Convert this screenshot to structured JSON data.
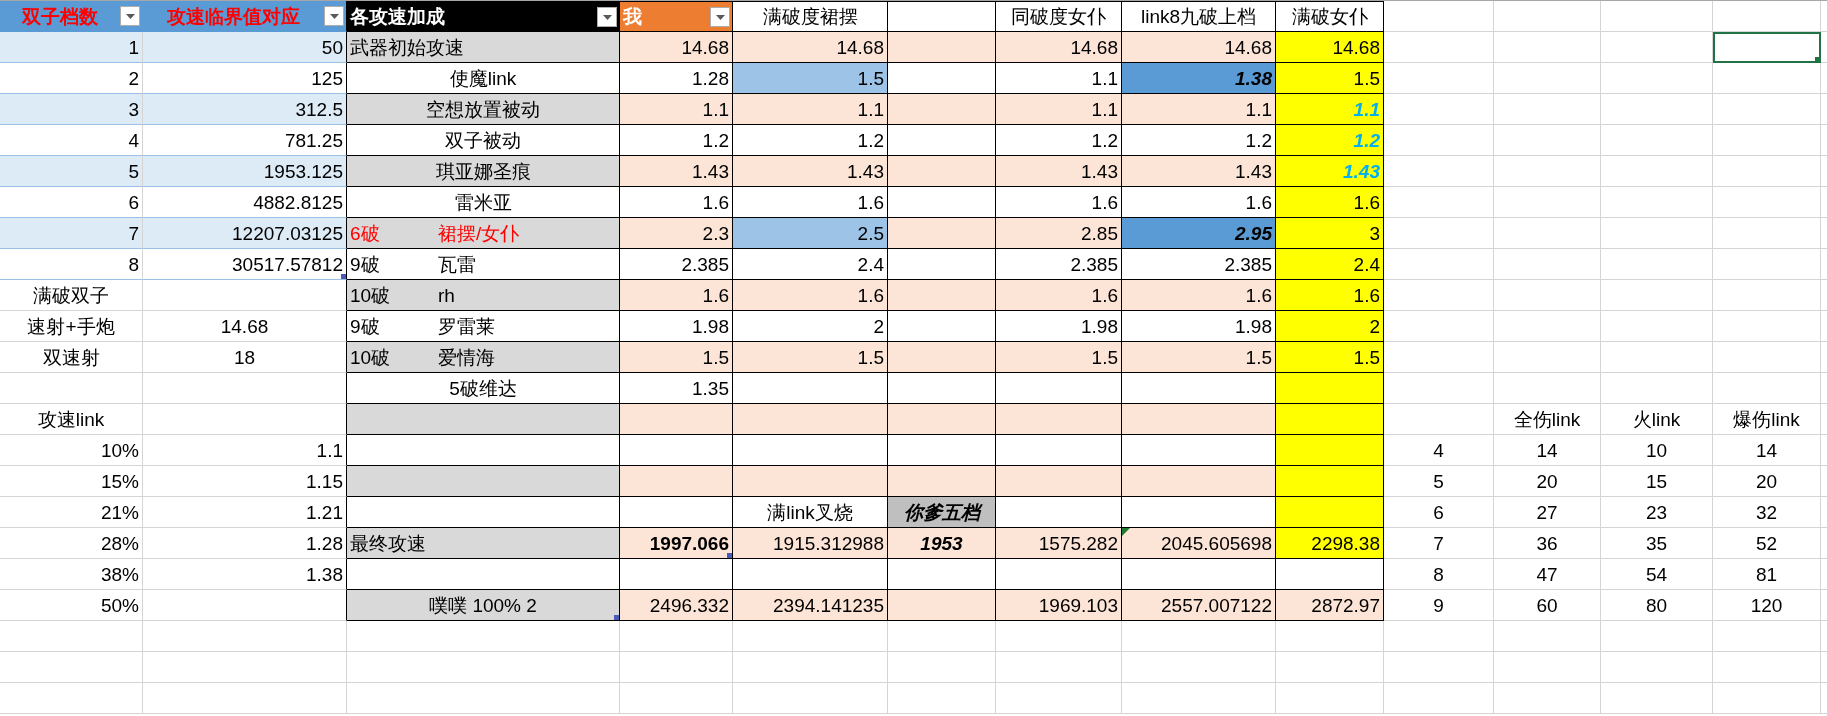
{
  "sheet": {
    "rows": [
      {
        "cells": [
          {
            "kind": "head-blue",
            "text": "双子档数",
            "centered": true,
            "bold": true,
            "color": "#ff0000",
            "filter": true
          },
          {
            "kind": "head-blue",
            "text": "攻速临界值对应",
            "centered": true,
            "bold": true,
            "color": "#ff0000",
            "filter": true
          },
          {
            "kind": "head-dark",
            "text": "各攻速加成",
            "left_aligned": true,
            "bold": true,
            "color": "#ffffff",
            "filter": true
          },
          {
            "kind": "head-orange",
            "text": "我",
            "left_aligned": true,
            "bold": true,
            "color": "#ffffff",
            "filter": true
          },
          {
            "kind": "cell",
            "text": "满破度裙摆",
            "centered": true
          },
          {
            "kind": "cell"
          },
          {
            "kind": "cell",
            "text": "同破度女仆",
            "centered": true
          },
          {
            "kind": "cell",
            "text": "link8九破上档",
            "centered": true
          },
          {
            "kind": "cell",
            "text": "满破女仆",
            "centered": true
          }
        ]
      },
      {
        "cells": [
          {
            "kind": "band",
            "text": "1"
          },
          {
            "kind": "band",
            "text": "50"
          },
          {
            "kind": "gray",
            "text": "武器初始攻速",
            "left_aligned": true
          },
          {
            "kind": "peach",
            "text": "14.68"
          },
          {
            "kind": "peach",
            "text": "14.68"
          },
          {
            "kind": "peach"
          },
          {
            "kind": "peach",
            "text": "14.68"
          },
          {
            "kind": "peach",
            "text": "14.68"
          },
          {
            "kind": "yellow",
            "text": "14.68"
          },
          {
            "kind": "plain"
          },
          {
            "kind": "plain"
          },
          {
            "kind": "plain"
          },
          {
            "kind": "plain",
            "selected": true
          }
        ]
      },
      {
        "cells": [
          {
            "kind": "band-white",
            "text": "2"
          },
          {
            "kind": "band-white",
            "text": "125"
          },
          {
            "kind": "cell",
            "text": "使魔link",
            "centered": true
          },
          {
            "kind": "cell",
            "text": "1.28"
          },
          {
            "kind": "light-blue",
            "text": "1.5"
          },
          {
            "kind": "cell"
          },
          {
            "kind": "cell",
            "text": "1.1"
          },
          {
            "kind": "blue",
            "text": "1.38",
            "bold": true,
            "italic": true
          },
          {
            "kind": "yellow",
            "text": "1.5"
          }
        ]
      },
      {
        "cells": [
          {
            "kind": "band",
            "text": "3"
          },
          {
            "kind": "band",
            "text": "312.5"
          },
          {
            "kind": "gray",
            "text": "空想放置被动",
            "centered": true
          },
          {
            "kind": "peach",
            "text": "1.1"
          },
          {
            "kind": "peach",
            "text": "1.1"
          },
          {
            "kind": "peach"
          },
          {
            "kind": "peach",
            "text": "1.1"
          },
          {
            "kind": "peach",
            "text": "1.1"
          },
          {
            "kind": "yellow",
            "text": "1.1",
            "bold": true,
            "italic": true,
            "color": "#00b0f0"
          }
        ]
      },
      {
        "cells": [
          {
            "kind": "band-white",
            "text": "4"
          },
          {
            "kind": "band-white",
            "text": "781.25"
          },
          {
            "kind": "cell",
            "text": "双子被动",
            "centered": true
          },
          {
            "kind": "cell",
            "text": "1.2"
          },
          {
            "kind": "cell",
            "text": "1.2"
          },
          {
            "kind": "cell"
          },
          {
            "kind": "cell",
            "text": "1.2"
          },
          {
            "kind": "cell",
            "text": "1.2"
          },
          {
            "kind": "yellow",
            "text": "1.2",
            "bold": true,
            "italic": true,
            "color": "#00b0f0"
          }
        ]
      },
      {
        "cells": [
          {
            "kind": "band",
            "text": "5"
          },
          {
            "kind": "band",
            "text": "1953.125"
          },
          {
            "kind": "gray",
            "text": "琪亚娜圣痕",
            "centered": true
          },
          {
            "kind": "peach",
            "text": "1.43"
          },
          {
            "kind": "peach",
            "text": "1.43"
          },
          {
            "kind": "peach"
          },
          {
            "kind": "peach",
            "text": "1.43"
          },
          {
            "kind": "peach",
            "text": "1.43"
          },
          {
            "kind": "yellow",
            "text": "1.43",
            "bold": true,
            "italic": true,
            "color": "#00b0f0"
          }
        ]
      },
      {
        "cells": [
          {
            "kind": "band-white",
            "text": "6"
          },
          {
            "kind": "band-white",
            "text": "4882.8125"
          },
          {
            "kind": "cell",
            "text": "雷米亚",
            "centered": true
          },
          {
            "kind": "cell",
            "text": "1.6"
          },
          {
            "kind": "cell",
            "text": "1.6"
          },
          {
            "kind": "cell"
          },
          {
            "kind": "cell",
            "text": "1.6"
          },
          {
            "kind": "cell",
            "text": "1.6"
          },
          {
            "kind": "yellow",
            "text": "1.6"
          }
        ]
      },
      {
        "cells": [
          {
            "kind": "band",
            "text": "7"
          },
          {
            "kind": "band",
            "text": "12207.03125"
          },
          {
            "kind": "gray",
            "prefix": "6破",
            "text": "裙摆/女仆",
            "left_aligned": true,
            "color": "#ff0000"
          },
          {
            "kind": "peach",
            "text": "2.3"
          },
          {
            "kind": "light-blue",
            "text": "2.5"
          },
          {
            "kind": "peach"
          },
          {
            "kind": "peach",
            "text": "2.85"
          },
          {
            "kind": "blue",
            "text": "2.95",
            "bold": true,
            "italic": true
          },
          {
            "kind": "yellow",
            "text": "3"
          }
        ]
      },
      {
        "cells": [
          {
            "kind": "band-white",
            "text": "8"
          },
          {
            "kind": "band-white",
            "text": "30517.57812",
            "corner_mark": true
          },
          {
            "kind": "cell",
            "prefix": "9破",
            "text": "瓦雷",
            "left_aligned": true
          },
          {
            "kind": "cell",
            "text": "2.385"
          },
          {
            "kind": "cell",
            "text": "2.4"
          },
          {
            "kind": "cell"
          },
          {
            "kind": "cell",
            "text": "2.385"
          },
          {
            "kind": "cell",
            "text": "2.385"
          },
          {
            "kind": "yellow",
            "text": "2.4"
          }
        ]
      },
      {
        "cells": [
          {
            "kind": "plain",
            "text": "满破双子",
            "centered": true
          },
          {
            "kind": "plain"
          },
          {
            "kind": "gray",
            "prefix": "10破",
            "text": "rh",
            "left_aligned": true
          },
          {
            "kind": "peach",
            "text": "1.6"
          },
          {
            "kind": "peach",
            "text": "1.6"
          },
          {
            "kind": "peach"
          },
          {
            "kind": "peach",
            "text": "1.6"
          },
          {
            "kind": "peach",
            "text": "1.6"
          },
          {
            "kind": "yellow",
            "text": "1.6"
          }
        ]
      },
      {
        "cells": [
          {
            "kind": "plain",
            "text": "速射+手炮",
            "centered": true
          },
          {
            "kind": "plain",
            "text": "14.68",
            "centered": true
          },
          {
            "kind": "cell",
            "prefix": "9破",
            "text": "罗雷莱",
            "left_aligned": true
          },
          {
            "kind": "cell",
            "text": "1.98"
          },
          {
            "kind": "cell",
            "text": "2"
          },
          {
            "kind": "cell"
          },
          {
            "kind": "cell",
            "text": "1.98"
          },
          {
            "kind": "cell",
            "text": "1.98"
          },
          {
            "kind": "yellow",
            "text": "2"
          }
        ]
      },
      {
        "cells": [
          {
            "kind": "plain",
            "text": "双速射",
            "centered": true
          },
          {
            "kind": "plain",
            "text": "18",
            "centered": true
          },
          {
            "kind": "gray",
            "prefix": "10破",
            "text": "爱情海",
            "left_aligned": true
          },
          {
            "kind": "peach",
            "text": "1.5"
          },
          {
            "kind": "peach",
            "text": "1.5"
          },
          {
            "kind": "peach"
          },
          {
            "kind": "peach",
            "text": "1.5"
          },
          {
            "kind": "peach",
            "text": "1.5"
          },
          {
            "kind": "yellow",
            "text": "1.5"
          }
        ]
      },
      {
        "cells": [
          {
            "kind": "plain"
          },
          {
            "kind": "plain"
          },
          {
            "kind": "cell",
            "text": "5破维达",
            "centered": true
          },
          {
            "kind": "cell",
            "text": "1.35"
          },
          {
            "kind": "cell"
          },
          {
            "kind": "cell"
          },
          {
            "kind": "cell"
          },
          {
            "kind": "cell"
          },
          {
            "kind": "yellow"
          }
        ]
      },
      {
        "cells": [
          {
            "kind": "plain",
            "text": "攻速link",
            "centered": true
          },
          {
            "kind": "plain"
          },
          {
            "kind": "gray"
          },
          {
            "kind": "peach"
          },
          {
            "kind": "peach"
          },
          {
            "kind": "peach"
          },
          {
            "kind": "peach"
          },
          {
            "kind": "peach"
          },
          {
            "kind": "yellow"
          },
          {
            "kind": "plain"
          },
          {
            "kind": "plain",
            "text": "全伤link",
            "centered": true
          },
          {
            "kind": "plain",
            "text": "火link",
            "centered": true
          },
          {
            "kind": "plain",
            "text": "爆伤link",
            "centered": true
          }
        ]
      },
      {
        "cells": [
          {
            "kind": "plain",
            "text": "10%"
          },
          {
            "kind": "plain",
            "text": "1.1"
          },
          {
            "kind": "cell"
          },
          {
            "kind": "cell"
          },
          {
            "kind": "cell"
          },
          {
            "kind": "cell"
          },
          {
            "kind": "cell"
          },
          {
            "kind": "cell"
          },
          {
            "kind": "yellow"
          },
          {
            "kind": "plain",
            "text": "4",
            "centered": true
          },
          {
            "kind": "plain",
            "text": "14",
            "centered": true
          },
          {
            "kind": "plain",
            "text": "10",
            "centered": true
          },
          {
            "kind": "plain",
            "text": "14",
            "centered": true
          }
        ]
      },
      {
        "cells": [
          {
            "kind": "plain",
            "text": "15%"
          },
          {
            "kind": "plain",
            "text": "1.15"
          },
          {
            "kind": "gray"
          },
          {
            "kind": "peach"
          },
          {
            "kind": "peach"
          },
          {
            "kind": "peach"
          },
          {
            "kind": "peach"
          },
          {
            "kind": "peach"
          },
          {
            "kind": "yellow"
          },
          {
            "kind": "plain",
            "text": "5",
            "centered": true
          },
          {
            "kind": "plain",
            "text": "20",
            "centered": true
          },
          {
            "kind": "plain",
            "text": "15",
            "centered": true
          },
          {
            "kind": "plain",
            "text": "20",
            "centered": true
          }
        ]
      },
      {
        "cells": [
          {
            "kind": "plain",
            "text": "21%"
          },
          {
            "kind": "plain",
            "text": "1.21"
          },
          {
            "kind": "cell"
          },
          {
            "kind": "cell"
          },
          {
            "kind": "cell",
            "text": "满link叉烧",
            "centered": true
          },
          {
            "kind": "dark-gray",
            "text": "你爹五档",
            "centered": true,
            "bold": true,
            "italic": true
          },
          {
            "kind": "cell"
          },
          {
            "kind": "cell"
          },
          {
            "kind": "yellow"
          },
          {
            "kind": "plain",
            "text": "6",
            "centered": true
          },
          {
            "kind": "plain",
            "text": "27",
            "centered": true
          },
          {
            "kind": "plain",
            "text": "23",
            "centered": true
          },
          {
            "kind": "plain",
            "text": "32",
            "centered": true
          }
        ]
      },
      {
        "cells": [
          {
            "kind": "plain",
            "text": "28%"
          },
          {
            "kind": "plain",
            "text": "1.28"
          },
          {
            "kind": "gray",
            "text": "最终攻速",
            "left_aligned": true
          },
          {
            "kind": "peach",
            "text": "1997.066",
            "bold": true,
            "corner_mark": true
          },
          {
            "kind": "peach",
            "text": "1915.312988"
          },
          {
            "kind": "peach",
            "text": "1953",
            "centered": true,
            "bold": true,
            "italic": true
          },
          {
            "kind": "peach",
            "text": "1575.282"
          },
          {
            "kind": "peach",
            "text": "2045.605698",
            "error_flag": true
          },
          {
            "kind": "yellow",
            "text": "2298.38"
          },
          {
            "kind": "plain",
            "text": "7",
            "centered": true
          },
          {
            "kind": "plain",
            "text": "36",
            "centered": true
          },
          {
            "kind": "plain",
            "text": "35",
            "centered": true
          },
          {
            "kind": "plain",
            "text": "52",
            "centered": true
          }
        ]
      },
      {
        "cells": [
          {
            "kind": "plain",
            "text": "38%"
          },
          {
            "kind": "plain",
            "text": "1.38"
          },
          {
            "kind": "cell"
          },
          {
            "kind": "cell"
          },
          {
            "kind": "cell"
          },
          {
            "kind": "cell"
          },
          {
            "kind": "cell"
          },
          {
            "kind": "cell"
          },
          {
            "kind": "cell"
          },
          {
            "kind": "plain",
            "text": "8",
            "centered": true
          },
          {
            "kind": "plain",
            "text": "47",
            "centered": true
          },
          {
            "kind": "plain",
            "text": "54",
            "centered": true
          },
          {
            "kind": "plain",
            "text": "81",
            "centered": true
          }
        ]
      },
      {
        "cells": [
          {
            "kind": "plain",
            "text": "50%"
          },
          {
            "kind": "plain"
          },
          {
            "kind": "gray",
            "text": "噗噗 100% 2",
            "centered": true,
            "corner_mark": true
          },
          {
            "kind": "peach",
            "text": "2496.332"
          },
          {
            "kind": "peach",
            "text": "2394.141235"
          },
          {
            "kind": "peach"
          },
          {
            "kind": "peach",
            "text": "1969.103"
          },
          {
            "kind": "peach",
            "text": "2557.007122"
          },
          {
            "kind": "peach",
            "text": "2872.97"
          },
          {
            "kind": "plain",
            "text": "9",
            "centered": true
          },
          {
            "kind": "plain",
            "text": "60",
            "centered": true
          },
          {
            "kind": "plain",
            "text": "80",
            "centered": true
          },
          {
            "kind": "plain",
            "text": "120",
            "centered": true
          }
        ]
      }
    ]
  }
}
